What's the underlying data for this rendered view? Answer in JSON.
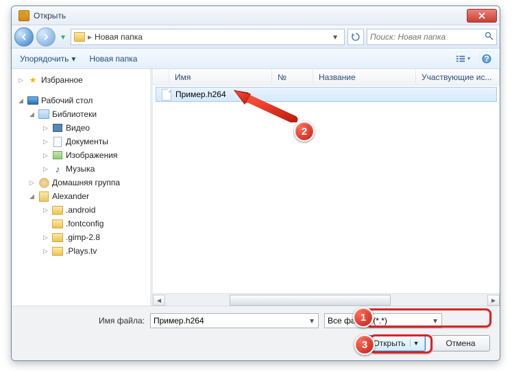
{
  "window": {
    "title": "Открыть"
  },
  "nav": {
    "breadcrumb": "Новая папка",
    "search_placeholder": "Поиск: Новая папка"
  },
  "toolbar": {
    "organize": "Упорядочить",
    "new_folder": "Новая папка"
  },
  "sidebar": {
    "favorites": "Избранное",
    "desktop": "Рабочий стол",
    "libraries": "Библиотеки",
    "video": "Видео",
    "documents": "Документы",
    "images": "Изображения",
    "music": "Музыка",
    "homegroup": "Домашняя группа",
    "user": "Alexander",
    "f1": ".android",
    "f2": ".fontconfig",
    "f3": ".gimp-2.8",
    "f4": ".Plays.tv"
  },
  "columns": {
    "name": "Имя",
    "num": "№",
    "title": "Название",
    "part": "Участвующие ис..."
  },
  "file": {
    "name": "Пример.h264"
  },
  "bottom": {
    "filename_label": "Имя файла:",
    "filename_value": "Пример.h264",
    "filter": "Все файлы (*.*)",
    "open": "Открыть",
    "cancel": "Отмена"
  },
  "callouts": {
    "b1": "1",
    "b2": "2",
    "b3": "3"
  }
}
